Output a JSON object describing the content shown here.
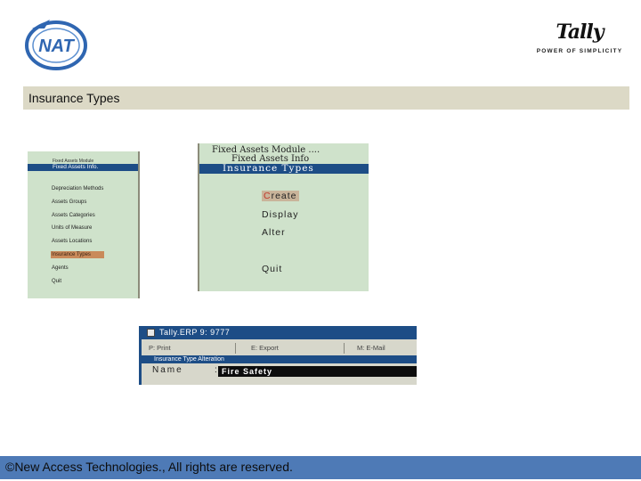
{
  "nat_logo": {
    "text": "NAT",
    "color": "#2f66b1"
  },
  "tally_logo": {
    "word": "Tally",
    "tagline": "POWER OF SIMPLICITY"
  },
  "title": "Insurance Types",
  "left_menu": {
    "top_text": "Fixed Assets Module",
    "header": "Fixed Assets Info.",
    "items": [
      {
        "label": "Depreciation Methods"
      },
      {
        "label": "Assets Groups"
      },
      {
        "label": "Assets Categories"
      },
      {
        "label": "Units of Measure"
      },
      {
        "label": "Assets Locations"
      },
      {
        "label": "Insurance Types",
        "highlighted": true
      },
      {
        "label": "Agents"
      },
      {
        "label": "Quit"
      }
    ]
  },
  "middle_menu": {
    "line1": "Fixed Assets Module ....",
    "line2": "Fixed Assets Info",
    "header": "Insurance Types",
    "items": [
      {
        "hotkey": "C",
        "rest": "reate",
        "selected": true
      },
      {
        "hotkey": "D",
        "rest": "isplay"
      },
      {
        "hotkey": "A",
        "rest": "lter"
      },
      {
        "hotkey": "Q",
        "rest": "uit"
      }
    ]
  },
  "tally_window": {
    "title": "Tally.ERP 9: 9777",
    "buttons": [
      "P: Print",
      "E: Export",
      "M: E-Mail"
    ],
    "subheader": "Insurance Type Alteration",
    "name_label": "Name",
    "name_value": "Fire Safety"
  },
  "footer": {
    "text": "©New Access Technologies., All rights are reserved.",
    "color": "#4e7ab6"
  }
}
